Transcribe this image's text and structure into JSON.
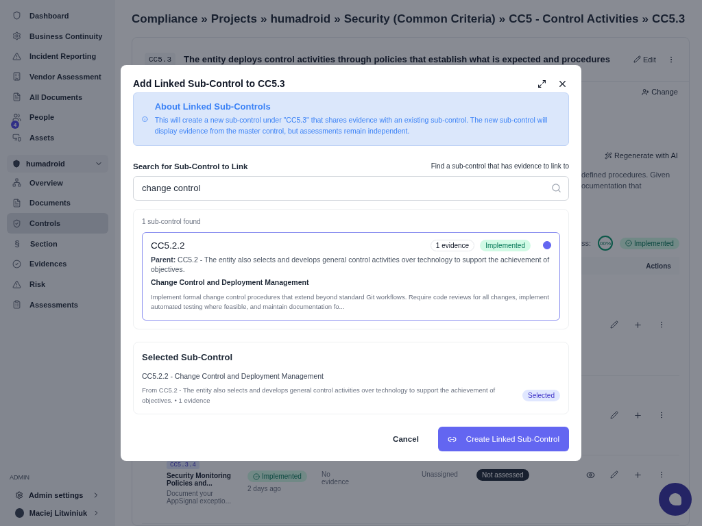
{
  "sidebar": {
    "items": [
      {
        "label": "Dashboard"
      },
      {
        "label": "Business Continuity"
      },
      {
        "label": "Incident Reporting"
      },
      {
        "label": "Vendor Assessment"
      },
      {
        "label": "All Documents"
      },
      {
        "label": "People",
        "badge": "4"
      },
      {
        "label": "Assets"
      }
    ],
    "workspace": {
      "label": "humadroid",
      "expanded": true
    },
    "project_items": [
      {
        "label": "Overview",
        "selected": false
      },
      {
        "label": "Documents",
        "selected": false
      },
      {
        "label": "Controls",
        "selected": true
      },
      {
        "label": "Section",
        "selected": false,
        "glyph": "§"
      },
      {
        "label": "Evidences",
        "selected": false
      },
      {
        "label": "Risk",
        "selected": false
      },
      {
        "label": "Assessments",
        "selected": false
      }
    ],
    "admin_heading": "ADMIN",
    "admin_settings": "Admin settings",
    "user": "Maciej Litwiniuk"
  },
  "breadcrumb": {
    "separator": "»",
    "items": [
      "Compliance",
      "Projects",
      "humadroid",
      "Security (Common Criteria)",
      "CC5 - Control Activities",
      "CC5.3"
    ]
  },
  "control": {
    "code": "CC5.3",
    "title": "The entity deploys control activities through policies that establish what is expected and procedures",
    "edit": "Edit",
    "change": "Change",
    "regenerate": "Regenerate with AI",
    "description_lines": [
      "defined procedures. Given",
      "ocumentation that"
    ],
    "progress_label": "ss:",
    "progress": "00%",
    "status": "Implemented",
    "actions_header": "Actions",
    "rows": [
      {
        "kind": "hidden"
      },
      {
        "kind": "hidden"
      },
      {
        "kind": "full",
        "code": "CC5.3.4",
        "name": "Security Monitoring Policies and...",
        "note": "Document your AppSignal exceptio...",
        "status": "Implemented",
        "updated": "2 days ago",
        "evidence": "No evidence",
        "assignee": "Unassigned",
        "assessment": "Not assessed"
      }
    ]
  },
  "modal": {
    "title": "Add Linked Sub-Control to CC5.3",
    "info": {
      "title": "About Linked Sub-Controls",
      "text": "This will create a new sub-control under \"CC5.3\" that shares evidence with an existing sub-control. The new sub-control will display evidence from the master control, but assessments remain independent."
    },
    "search_label": "Search for Sub-Control to Link",
    "search_hint": "Find a sub-control that has evidence to link to",
    "search_value": "change control",
    "results_count": "1 sub-control found",
    "results": [
      {
        "code": "CC5.2.2",
        "evidence": "1 evidence",
        "status": "Implemented",
        "selected": true,
        "parent": "**Parent:** CC5.2 - The entity also selects and develops general control activities over technology to support the achievement of objectives.",
        "name": "Change Control and Deployment Management",
        "description": "Implement formal change control procedures that extend beyond standard Git workflows. Require code reviews for all changes, implement automated testing where feasible, and maintain documentation fo..."
      }
    ],
    "selected_heading": "Selected Sub-Control",
    "selected_title": "CC5.2.2 - Change Control and Deployment Management",
    "selected_text": "From CC5.2 - The entity also selects and develops general control activities over technology to support the achievement of objectives. • 1 evidence",
    "selected_badge": "Selected",
    "cancel": "Cancel",
    "create": "Create Linked Sub-Control"
  }
}
